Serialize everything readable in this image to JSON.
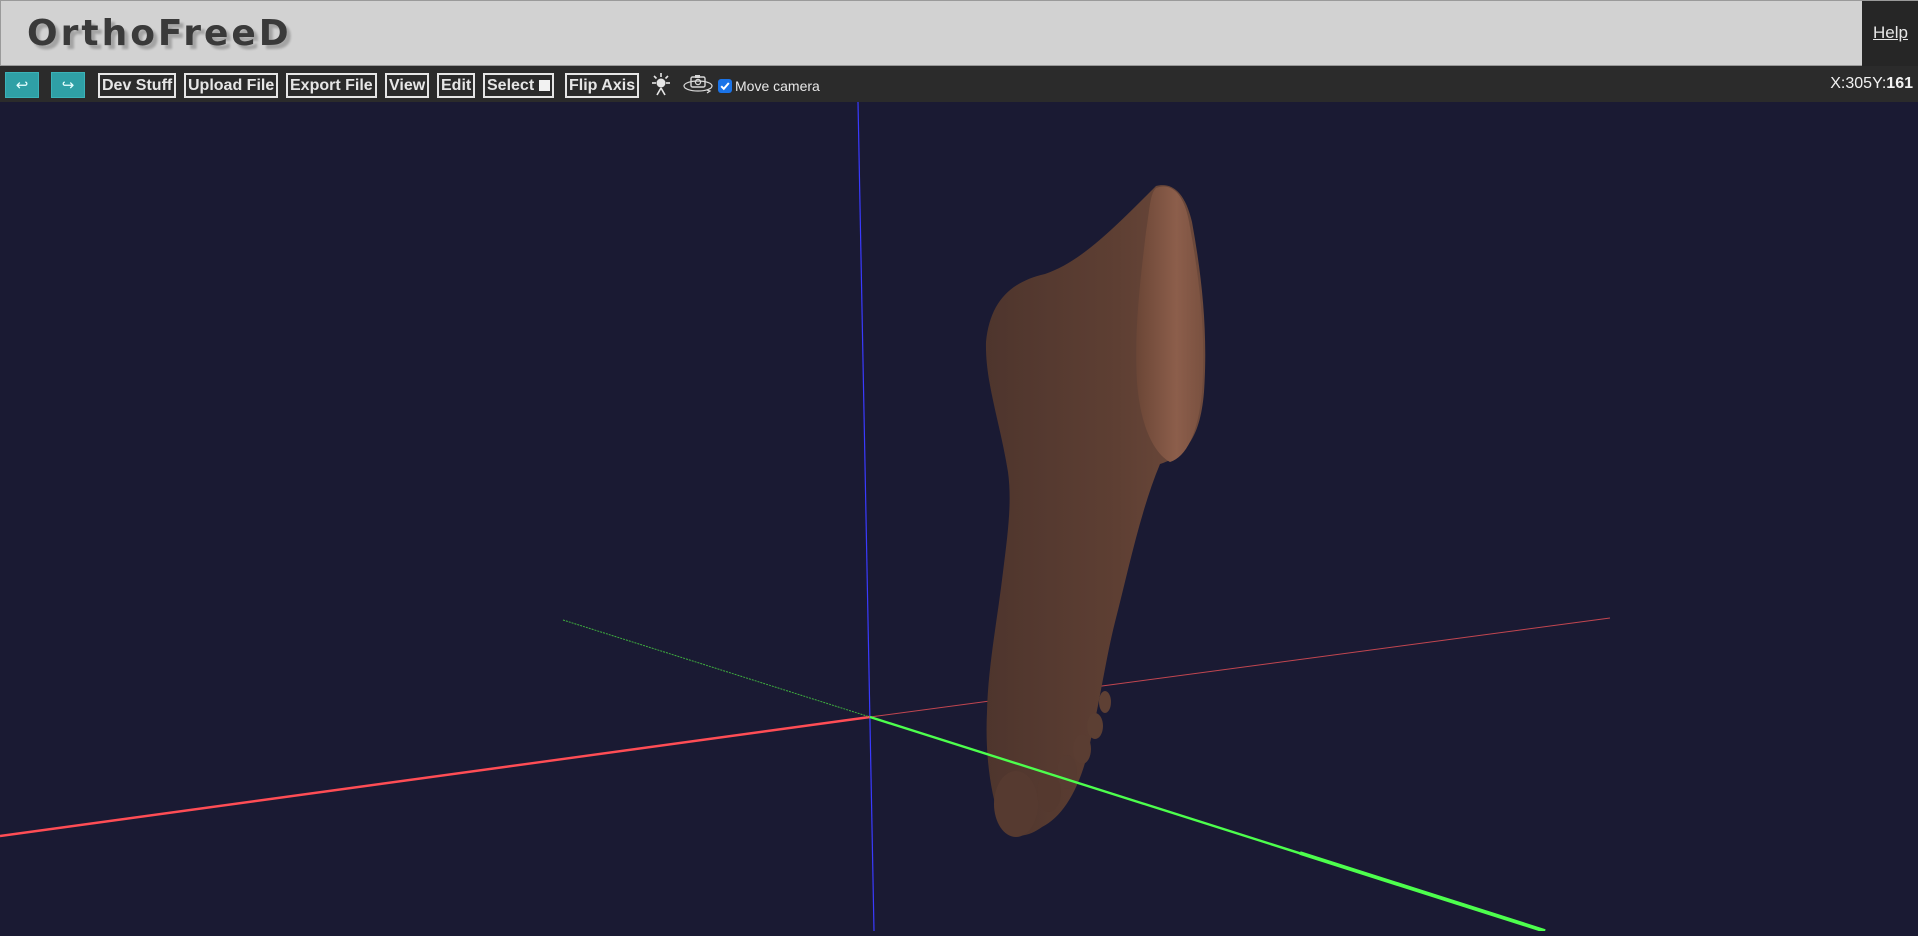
{
  "app": {
    "logo": "OrthoFreeD",
    "help_label": "Help"
  },
  "toolbar": {
    "undo_icon": "undo-arrow-icon",
    "redo_icon": "redo-arrow-icon",
    "undo_glyph": "↩",
    "redo_glyph": "↪",
    "buttons": {
      "dev_stuff": "Dev Stuff",
      "upload_file": "Upload File",
      "export_file": "Export File",
      "view": "View",
      "edit": "Edit",
      "select": "Select",
      "flip_axis": "Flip Axis"
    },
    "light_icon": "light-bulb-icon",
    "camera_icon": "camera-rotate-icon",
    "move_camera_label": "Move camera",
    "move_camera_checked": true
  },
  "coordinates": {
    "x_label": "X:",
    "x_value": "305",
    "y_label": "Y:",
    "y_value": "161"
  },
  "viewport": {
    "background": "#1a1a33",
    "x_axis_color": "#ff4d4d",
    "y_axis_color": "#4dff4d",
    "z_axis_color": "#3a3aff",
    "model_color": "#5e3f33",
    "model": "foot-3d-model"
  }
}
